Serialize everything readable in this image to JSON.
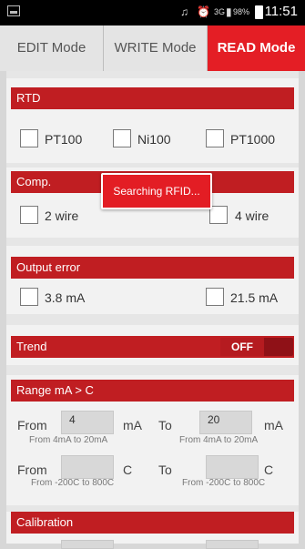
{
  "status_bar": {
    "network": "3G",
    "battery": "98%",
    "time": "11:51"
  },
  "tabs": [
    {
      "label": "EDIT Mode",
      "active": false
    },
    {
      "label": "WRITE Mode",
      "active": false
    },
    {
      "label": "READ Mode",
      "active": true
    }
  ],
  "sections": {
    "rtd": {
      "title": "RTD",
      "options": [
        "PT100",
        "Ni100",
        "PT1000"
      ]
    },
    "comp": {
      "title": "Comp.",
      "options": [
        "2 wire",
        "4 wire"
      ]
    },
    "output_error": {
      "title": "Output error",
      "options": [
        "3.8 mA",
        "21.5 mA"
      ]
    },
    "trend": {
      "title": "Trend",
      "toggle_label": "OFF"
    },
    "range": {
      "title": "Range mA > C",
      "row1": {
        "from_label": "From",
        "from_value": "4",
        "from_unit": "mA",
        "to_label": "To",
        "to_value": "20",
        "to_unit": "mA",
        "from_hint": "From 4mA to 20mA",
        "to_hint": "From 4mA to 20mA"
      },
      "row2": {
        "from_label": "From",
        "from_value": "",
        "from_unit": "C",
        "to_label": "To",
        "to_value": "",
        "to_unit": "C",
        "from_hint": "From -200C to 800C",
        "to_hint": "From -200C to 800C"
      }
    },
    "calibration": {
      "title": "Calibration"
    }
  },
  "toast": "Searching RFID...",
  "colors": {
    "accent": "#e41e25",
    "header_red": "#c01e22"
  }
}
